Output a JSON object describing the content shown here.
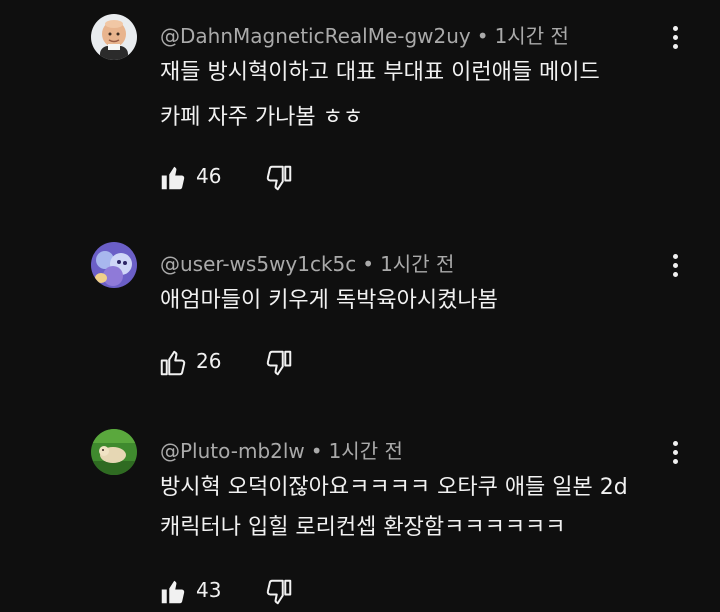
{
  "comments": [
    {
      "author": "@DahnMagneticRealMe-gw2uy",
      "separator": "•",
      "time": "1시간 전",
      "lines": [
        "재들 방시혁이하고 대표 부대표 이런애들 메이드",
        "카페 자주 가나봄 ㅎㅎ"
      ],
      "likes": "46",
      "liked": true,
      "avatar_icon": "bald-man-avatar"
    },
    {
      "author": "@user-ws5wy1ck5c",
      "separator": "•",
      "time": "1시간 전",
      "lines": [
        "애엄마들이 키우게 독박육아시켰나봄"
      ],
      "likes": "26",
      "liked": false,
      "avatar_icon": "purple-doll-avatar"
    },
    {
      "author": "@Pluto-mb2lw",
      "separator": "•",
      "time": "1시간 전",
      "lines": [
        "방시혁 오덕이잖아요ㅋㅋㅋㅋ 오타쿠 애들 일본 2d",
        "캐릭터나 입힐 로리컨셉 환장함ㅋㅋㅋㅋㅋㅋ"
      ],
      "likes": "43",
      "liked": true,
      "avatar_icon": "green-grass-avatar"
    }
  ]
}
